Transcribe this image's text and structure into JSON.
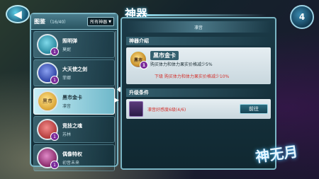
{
  "page": {
    "title": "神器",
    "page_number": "4"
  },
  "left_panel": {
    "header_title": "图鉴",
    "count": "（16/40）",
    "filter": {
      "selected": "所有神器"
    },
    "items": [
      {
        "name": "照明弹",
        "owner": "莫妮",
        "badge": "1",
        "icon_color": "#2a8aa0",
        "selected": false
      },
      {
        "name": "大天使之剑",
        "owner": "菲娜",
        "badge": "1",
        "icon_color": "#3046a8",
        "selected": false
      },
      {
        "name": "黑市金卡",
        "owner": "凛音",
        "badge": "",
        "icon_color": "#d9a437",
        "selected": true
      },
      {
        "name": "竞技之魂",
        "owner": "苏林",
        "badge": "1",
        "icon_color": "#b23a3a",
        "selected": false
      },
      {
        "name": "偶像特权",
        "owner": "初音未来",
        "badge": "1",
        "icon_color": "#8a2a6a",
        "selected": false
      }
    ]
  },
  "detail": {
    "owner": "凛音",
    "intro_heading": "神器介绍",
    "artifact_name": "黑市金卡",
    "artifact_badge": "1",
    "icon_label": "黑市",
    "description": "购买体力和体力果实价格减少5%",
    "next_level": "下级 购买体力和体力果实价格减少10%",
    "upgrade_heading": "升级条件",
    "condition": "凛音好感度6级(4/6)",
    "go_button": "前往"
  },
  "logo_text": "神无月"
}
